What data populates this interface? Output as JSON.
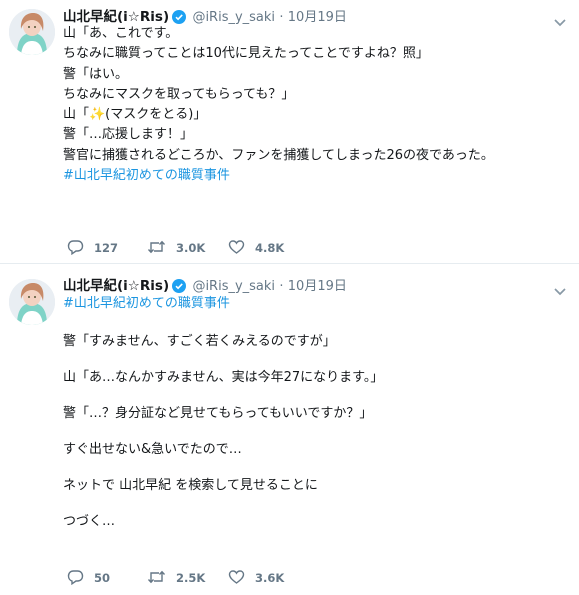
{
  "tweets": [
    {
      "name": "山北早紀(i☆Ris)",
      "handle": "@iRis_y_saki",
      "separator": "·",
      "date": "10月19日",
      "body_lines": [
        "山「あ、これです。",
        "ちなみに職質ってことは10代に見えたってことですよね？照」",
        "警「はい。",
        "ちなみにマスクを取ってもらっても？」",
        "山「✨(マスクをとる)」",
        "警「…応援します！」",
        "",
        "警官に捕獲されるどころか、ファンを捕獲してしまった26の夜であった。",
        ""
      ],
      "hashtag": "#山北早紀初めての職質事件",
      "replies": "127",
      "retweets": "3.0K",
      "likes": "4.8K"
    },
    {
      "name": "山北早紀(i☆Ris)",
      "handle": "@iRis_y_saki",
      "separator": "·",
      "date": "10月19日",
      "hashtag": "#山北早紀初めての職質事件",
      "body_lines": [
        "",
        "警「すみません、すごく若くみえるのですが」",
        "",
        "山「あ…なんかすみません、実は今年27になります。」",
        "",
        "警「…？身分証など見せてもらってもいいですか？」",
        "",
        "すぐ出せない&急いでたので…",
        "",
        "ネットで 山北早紀 を検索して見せることに",
        "",
        "つづく…"
      ],
      "replies": "50",
      "retweets": "2.5K",
      "likes": "3.6K"
    }
  ],
  "icons": {
    "verified": "verified-badge-icon",
    "menu": "chevron-down-icon",
    "reply": "reply-icon",
    "retweet": "retweet-icon",
    "like": "heart-icon"
  },
  "colors": {
    "verified": "#1da1f2",
    "hashtag": "#1b95e0",
    "meta": "#657786",
    "divider": "#e6ecf0"
  }
}
